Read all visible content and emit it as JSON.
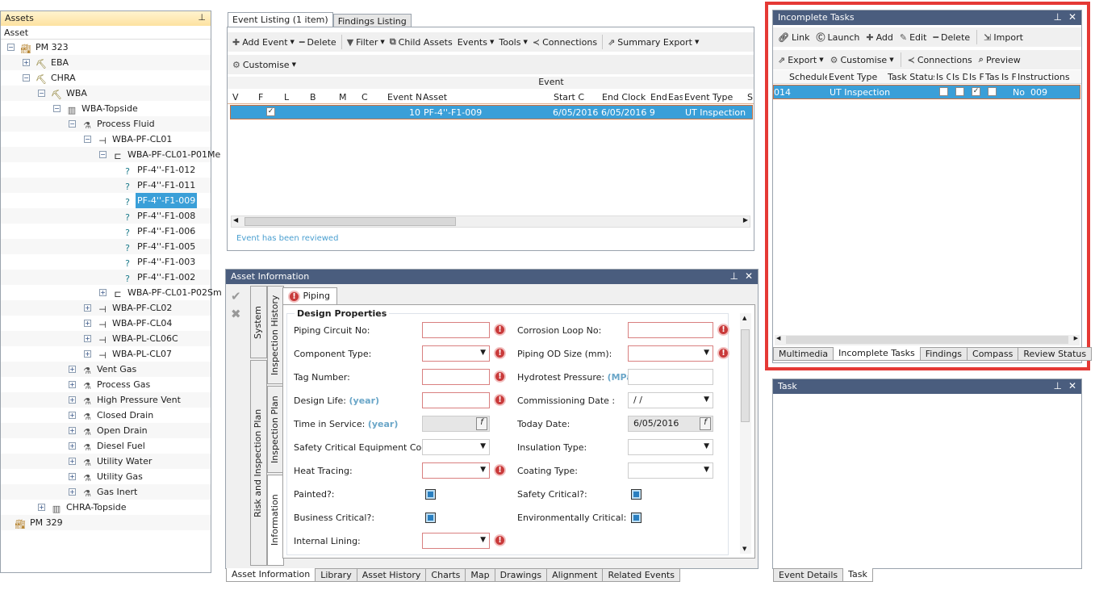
{
  "assets": {
    "title": "Assets",
    "column": "Asset",
    "rows": [
      {
        "label": "PM 323",
        "level": 0,
        "toggle": "-",
        "icon": "platform"
      },
      {
        "label": "EBA",
        "level": 1,
        "toggle": "+",
        "icon": "rig"
      },
      {
        "label": "CHRA",
        "level": 1,
        "toggle": "-",
        "icon": "rig"
      },
      {
        "label": "WBA",
        "level": 2,
        "toggle": "-",
        "icon": "rig"
      },
      {
        "label": "WBA-Topside",
        "level": 3,
        "toggle": "-",
        "icon": "topside"
      },
      {
        "label": "Process Fluid",
        "level": 4,
        "toggle": "-",
        "icon": "system"
      },
      {
        "label": "WBA-PF-CL01",
        "level": 5,
        "toggle": "-",
        "icon": "circuit"
      },
      {
        "label": "WBA-PF-CL01-P01Me",
        "level": 6,
        "toggle": "-",
        "icon": "pipe"
      },
      {
        "label": "PF-4''-F1-012",
        "level": 7,
        "toggle": "",
        "icon": "unknown"
      },
      {
        "label": "PF-4''-F1-011",
        "level": 7,
        "toggle": "",
        "icon": "unknown"
      },
      {
        "label": "PF-4''-F1-009",
        "level": 7,
        "toggle": "",
        "icon": "unknown",
        "selected": true
      },
      {
        "label": "PF-4''-F1-008",
        "level": 7,
        "toggle": "",
        "icon": "unknown"
      },
      {
        "label": "PF-4''-F1-006",
        "level": 7,
        "toggle": "",
        "icon": "unknown"
      },
      {
        "label": "PF-4''-F1-005",
        "level": 7,
        "toggle": "",
        "icon": "unknown"
      },
      {
        "label": "PF-4''-F1-003",
        "level": 7,
        "toggle": "",
        "icon": "unknown"
      },
      {
        "label": "PF-4''-F1-002",
        "level": 7,
        "toggle": "",
        "icon": "unknown"
      },
      {
        "label": "WBA-PF-CL01-P02Sm",
        "level": 6,
        "toggle": "+",
        "icon": "pipe"
      },
      {
        "label": "WBA-PF-CL02",
        "level": 5,
        "toggle": "+",
        "icon": "circuit"
      },
      {
        "label": "WBA-PF-CL04",
        "level": 5,
        "toggle": "+",
        "icon": "circuit"
      },
      {
        "label": "WBA-PL-CL06C",
        "level": 5,
        "toggle": "+",
        "icon": "circuit"
      },
      {
        "label": "WBA-PL-CL07",
        "level": 5,
        "toggle": "+",
        "icon": "circuit"
      },
      {
        "label": "Vent Gas",
        "level": 4,
        "toggle": "+",
        "icon": "system"
      },
      {
        "label": "Process Gas",
        "level": 4,
        "toggle": "+",
        "icon": "system"
      },
      {
        "label": "High Pressure Vent",
        "level": 4,
        "toggle": "+",
        "icon": "system"
      },
      {
        "label": "Closed Drain",
        "level": 4,
        "toggle": "+",
        "icon": "system"
      },
      {
        "label": "Open Drain",
        "level": 4,
        "toggle": "+",
        "icon": "system"
      },
      {
        "label": "Diesel Fuel",
        "level": 4,
        "toggle": "+",
        "icon": "system"
      },
      {
        "label": "Utility Water",
        "level": 4,
        "toggle": "+",
        "icon": "system"
      },
      {
        "label": "Utility Gas",
        "level": 4,
        "toggle": "+",
        "icon": "system"
      },
      {
        "label": "Gas Inert",
        "level": 4,
        "toggle": "+",
        "icon": "system"
      },
      {
        "label": "CHRA-Topside",
        "level": 2,
        "toggle": "+",
        "icon": "topside"
      },
      {
        "label": "PM 329",
        "level": 0,
        "toggle": "",
        "icon": "platform"
      }
    ]
  },
  "events": {
    "tabs": [
      "Event Listing (1 item)",
      "Findings Listing"
    ],
    "toolbar1": [
      "Add Event",
      "Delete",
      "Filter",
      "Child Assets",
      "Events",
      "Tools",
      "Connections",
      "Summary Export"
    ],
    "toolbar2": [
      "Customise"
    ],
    "group_header": "Event",
    "columns": [
      "V",
      "F",
      "L",
      "B",
      "M",
      "C",
      "Event N",
      "Asset",
      "Start C",
      "End Clock",
      "End",
      "Eas",
      "Event Type",
      "S"
    ],
    "row": {
      "event_no": "10",
      "asset": "PF-4''-F1-009",
      "start": "6/05/2016",
      "end": "6/05/2016 9",
      "type": "UT Inspection",
      "f_checked": true
    },
    "status": "Event has been reviewed"
  },
  "asset_info": {
    "title": "Asset Information",
    "tab": "Piping",
    "section": "Design Properties",
    "vtabs": [
      "System",
      "Inspection History",
      "Risk and Inspection Plan",
      "Inspection Plan",
      "Information"
    ],
    "left": [
      {
        "label": "Piping Circuit No:",
        "type": "text",
        "req": true
      },
      {
        "label": "Component Type:",
        "type": "dd",
        "req": true
      },
      {
        "label": "Tag Number:",
        "type": "text",
        "req": true
      },
      {
        "label": "Design Life:",
        "unit": "(year)",
        "type": "text",
        "req": true
      },
      {
        "label": "Time in Service:",
        "unit": "(year)",
        "type": "fx"
      },
      {
        "label": "Safety Critical Equipment Code:",
        "type": "dd"
      },
      {
        "label": "Heat Tracing:",
        "type": "dd",
        "req": true
      },
      {
        "label": "Painted?:",
        "type": "cb"
      },
      {
        "label": "Business Critical?:",
        "type": "cb"
      },
      {
        "label": "Internal Lining:",
        "type": "dd",
        "req": true
      }
    ],
    "right": [
      {
        "label": "Corrosion Loop No:",
        "type": "text",
        "req": true
      },
      {
        "label": "Piping OD Size (mm):",
        "type": "dd",
        "req": true
      },
      {
        "label": "Hydrotest Pressure:",
        "unit": "(MPa)",
        "type": "text"
      },
      {
        "label": "Commissioning Date :",
        "type": "dd",
        "value": "/ /"
      },
      {
        "label": "Today Date:",
        "type": "fx",
        "value": "6/05/2016"
      },
      {
        "label": "Insulation Type:",
        "type": "dd"
      },
      {
        "label": "Coating Type:",
        "type": "dd"
      },
      {
        "label": "Safety Critical?:",
        "type": "cb"
      },
      {
        "label": "Environmentally Critical:",
        "type": "cb"
      }
    ],
    "bottom_tabs": [
      "Asset Information",
      "Library",
      "Asset History",
      "Charts",
      "Map",
      "Drawings",
      "Alignment",
      "Related Events"
    ]
  },
  "tasks": {
    "title": "Incomplete Tasks",
    "toolbar1": [
      "Link",
      "Launch",
      "Add",
      "Edit",
      "Delete",
      "Import"
    ],
    "toolbar2": [
      "Export",
      "Customise",
      "Connections",
      "Preview"
    ],
    "columns": [
      "Schedule",
      "Event Type",
      "Task Status",
      "Is C",
      "Is D",
      "Is F",
      "Tas",
      "Is F",
      "Instructions"
    ],
    "row": {
      "schedule": "014",
      "type": "UT Inspection",
      "checks": [
        false,
        false,
        true,
        false
      ],
      "isf": "No",
      "instructions": "009"
    },
    "bottom_tabs": [
      "Multimedia",
      "Incomplete Tasks",
      "Findings",
      "Compass",
      "Review Status"
    ]
  },
  "task": {
    "title": "Task",
    "bottom_tabs": [
      "Event Details",
      "Task"
    ]
  },
  "colors": {
    "highlight": "#e53935",
    "selection": "#3a9fd8",
    "titlebar": "#4a5d7e"
  }
}
